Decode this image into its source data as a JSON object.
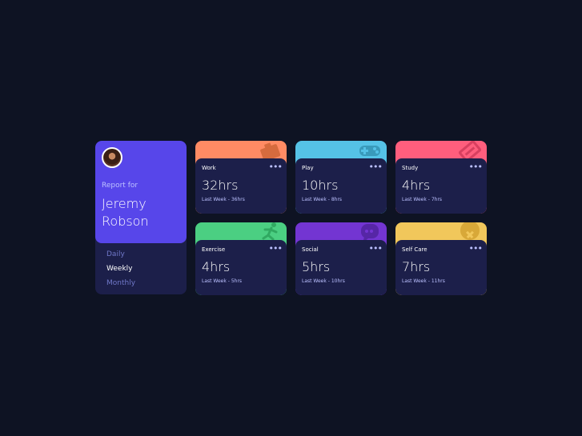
{
  "profile": {
    "report_label": "Report for",
    "user_name": "Jeremy Robson",
    "periods": [
      {
        "label": "Daily",
        "active": false
      },
      {
        "label": "Weekly",
        "active": true
      },
      {
        "label": "Monthly",
        "active": false
      }
    ]
  },
  "cards": [
    {
      "title": "Work",
      "hours": "32hrs",
      "previous": "Last Week - 36hrs",
      "color": "#ff8b64",
      "icon": "briefcase-icon"
    },
    {
      "title": "Play",
      "hours": "10hrs",
      "previous": "Last Week - 8hrs",
      "color": "#55c2e6",
      "icon": "gamepad-icon"
    },
    {
      "title": "Study",
      "hours": "4hrs",
      "previous": "Last Week - 7hrs",
      "color": "#ff5e7d",
      "icon": "book-icon"
    },
    {
      "title": "Exercise",
      "hours": "4hrs",
      "previous": "Last Week - 5hrs",
      "color": "#4bcf82",
      "icon": "runner-icon"
    },
    {
      "title": "Social",
      "hours": "5hrs",
      "previous": "Last Week - 10hrs",
      "color": "#7335d2",
      "icon": "chat-bubble-icon"
    },
    {
      "title": "Self Care",
      "hours": "7hrs",
      "previous": "Last Week - 11hrs",
      "color": "#f1c75b",
      "icon": "heart-icon"
    }
  ],
  "menu_dots": "•••"
}
